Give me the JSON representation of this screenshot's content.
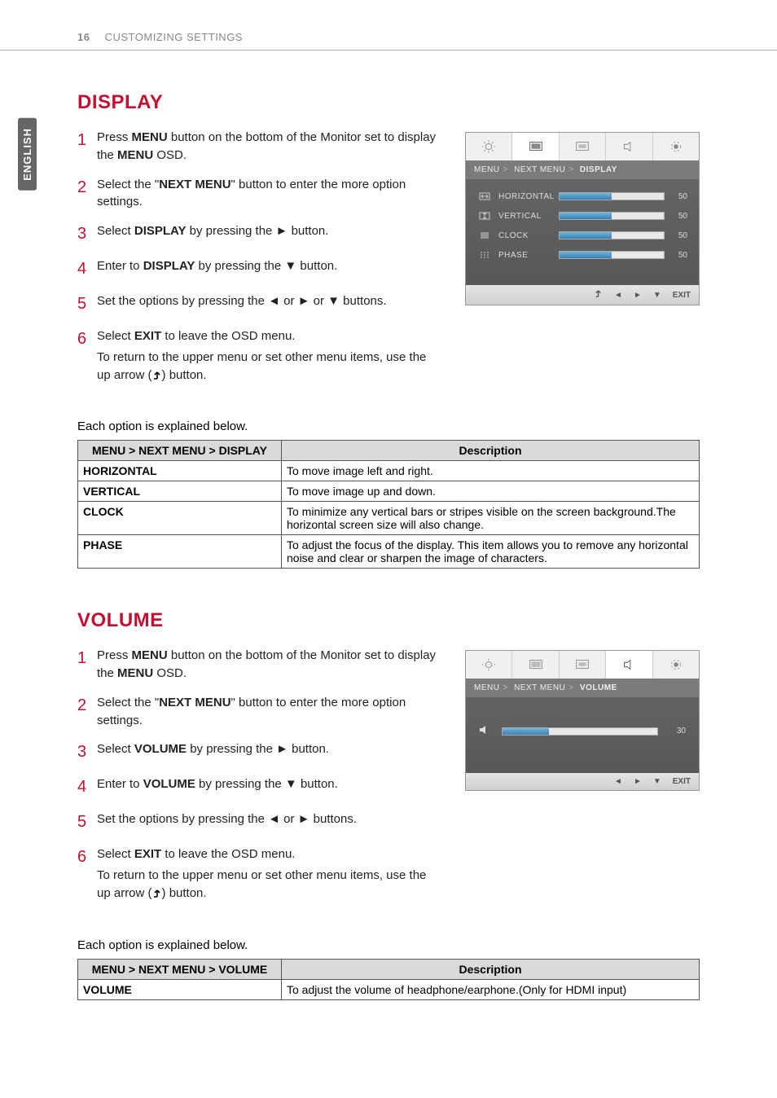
{
  "header": {
    "page_number": "16",
    "title": "CUSTOMIZING SETTINGS"
  },
  "lang_tab": "ENGLISH",
  "sections": {
    "display": {
      "title": "DISPLAY",
      "steps": [
        {
          "n": "1",
          "html": "Press <strong>MENU</strong> button on the bottom of the Monitor set to display the <strong>MENU</strong> OSD."
        },
        {
          "n": "2",
          "html": "Select the \"<strong>NEXT MENU</strong>\" button to enter the more option settings."
        },
        {
          "n": "3",
          "html": "Select <strong>DISPLAY</strong> by pressing the ► button."
        },
        {
          "n": "4",
          "html": "Enter to <strong>DISPLAY</strong> by pressing the ▼ button."
        },
        {
          "n": "5",
          "html": "Set the options by pressing the ◄ or ► or ▼ buttons."
        },
        {
          "n": "6",
          "html": "Select <strong>EXIT</strong> to leave the OSD menu.",
          "sub": "To return to the upper menu or set other menu items, use the up arrow (@UP@) button."
        }
      ],
      "explain_intro": "Each option is explained below.",
      "table": {
        "head": [
          "MENU > NEXT MENU > DISPLAY",
          "Description"
        ],
        "rows": [
          [
            "HORIZONTAL",
            "To move image left and right."
          ],
          [
            "VERTICAL",
            "To move image up and down."
          ],
          [
            "CLOCK",
            "To minimize any vertical bars or stripes visible on the screen background.The horizontal screen size will also change."
          ],
          [
            "PHASE",
            "To adjust the focus of the display. This item allows you to remove any horizontal noise and clear or sharpen the image of characters."
          ]
        ]
      }
    },
    "volume": {
      "title": "VOLUME",
      "steps": [
        {
          "n": "1",
          "html": "Press <strong>MENU</strong> button on the bottom of the Monitor set to display the <strong>MENU</strong> OSD."
        },
        {
          "n": "2",
          "html": "Select the \"<strong>NEXT MENU</strong>\" button to enter the more option settings."
        },
        {
          "n": "3",
          "html": "Select <strong>VOLUME</strong> by pressing the ► button."
        },
        {
          "n": "4",
          "html": "Enter to <strong>VOLUME</strong> by pressing the ▼ button."
        },
        {
          "n": "5",
          "html": "Set the options by pressing the ◄ or ► buttons."
        },
        {
          "n": "6",
          "html": "Select <strong>EXIT</strong> to leave the OSD menu.",
          "sub": "To return to the upper menu or set other menu items, use the up arrow (@UP@) button."
        }
      ],
      "explain_intro": "Each option is explained below.",
      "table": {
        "head": [
          "MENU > NEXT MENU > VOLUME",
          "Description"
        ],
        "rows": [
          [
            "VOLUME",
            "To adjust the volume of headphone/earphone.(Only for HDMI input)"
          ]
        ]
      }
    }
  },
  "osd": {
    "display": {
      "crumbs": [
        "MENU",
        "NEXT MENU",
        "DISPLAY"
      ],
      "rows": [
        {
          "label": "HORIZONTAL",
          "value": 50
        },
        {
          "label": "VERTICAL",
          "value": 50
        },
        {
          "label": "CLOCK",
          "value": 50
        },
        {
          "label": "PHASE",
          "value": 50
        }
      ],
      "footer": [
        "◄",
        "►",
        "▼",
        "EXIT"
      ]
    },
    "volume": {
      "crumbs": [
        "MENU",
        "NEXT MENU",
        "VOLUME"
      ],
      "value": 30,
      "footer": [
        "◄",
        "►",
        "▼",
        "EXIT"
      ]
    }
  }
}
